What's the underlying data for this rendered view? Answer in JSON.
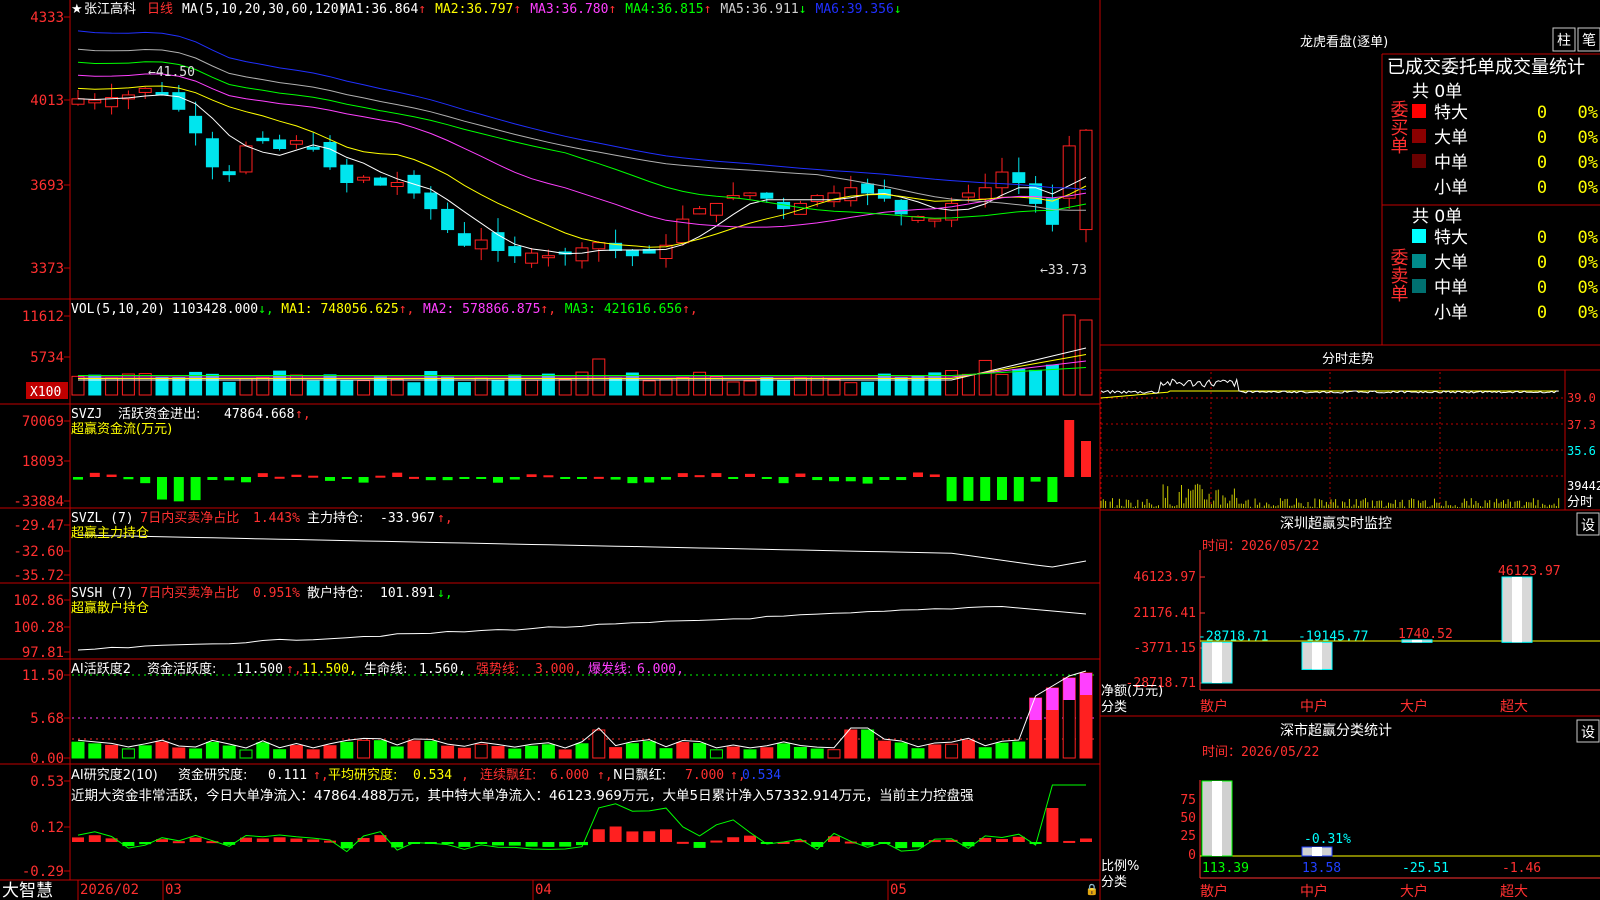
{
  "app": {
    "brand": "大智慧"
  },
  "stock": {
    "star": "★",
    "name": "张江高科",
    "period": "日线"
  },
  "colors": {
    "bg": "#000000",
    "grid": "#c00000",
    "up": "#ff2020",
    "down": "#00e5ee",
    "ma1": "#ffffff",
    "ma2": "#ffff00",
    "ma3": "#ff40ff",
    "ma4": "#00ff00",
    "ma5": "#b0b0b0",
    "ma6": "#2030ff"
  },
  "main": {
    "ma_params": "MA(5,10,20,30,60,120)",
    "ma_values": [
      {
        "label": "MA1:",
        "value": "36.864",
        "arrow": "↑",
        "color": "#ffffff"
      },
      {
        "label": "MA2:",
        "value": "36.797",
        "arrow": "↑",
        "color": "#ffff00"
      },
      {
        "label": "MA3:",
        "value": "36.780",
        "arrow": "↑",
        "color": "#ff40ff"
      },
      {
        "label": "MA4:",
        "value": "36.815",
        "arrow": "↑",
        "color": "#00ff00"
      },
      {
        "label": "MA5:",
        "value": "36.911",
        "arrow": "↓",
        "color": "#d0d0d0"
      },
      {
        "label": "MA6:",
        "value": "39.356",
        "arrow": "↓",
        "color": "#2030ff"
      }
    ],
    "yticks": [
      "4333",
      "4013",
      "3693",
      "3373"
    ],
    "high_label": "41.50",
    "low_label": "33.73"
  },
  "vol": {
    "title": "VOL(5,10,20)",
    "values": [
      {
        "label": "",
        "value": "1103428.000",
        "arrow": "↓",
        "color": "#ffffff"
      },
      {
        "label": "MA1:",
        "value": "748056.625",
        "arrow": "↑",
        "color": "#ffff00"
      },
      {
        "label": "MA2:",
        "value": "578866.875",
        "arrow": "↑",
        "color": "#ff40ff"
      },
      {
        "label": "MA3:",
        "value": "421616.656",
        "arrow": "↑",
        "color": "#00ff00"
      }
    ],
    "yticks": [
      "11612",
      "5734"
    ],
    "unit": "X100"
  },
  "svzj": {
    "title": "SVZJ",
    "label1": "活跃资金进出:",
    "value1": "47864.668",
    "arrow1": "↑,",
    "subtitle": "超赢资金流(万元)",
    "yticks": [
      "70069",
      "18093",
      "-33884"
    ]
  },
  "svzl": {
    "title": "SVZL (7)",
    "label1": "7日内买卖净占比",
    "value1": "1.443%",
    "label2": "主力持仓:",
    "value2": "-33.967",
    "arrow2": "↑,",
    "subtitle": "超赢主力持仓",
    "yticks": [
      "-29.47",
      "-32.60",
      "-35.72"
    ]
  },
  "svsh": {
    "title": "SVSH (7)",
    "label1": "7日内买卖净占比",
    "value1": "0.951%",
    "label2": "散户持仓:",
    "value2": "101.891",
    "arrow2": "↓,",
    "subtitle": "超赢散户持仓",
    "yticks": [
      "102.86",
      "100.28",
      "97.81"
    ]
  },
  "ai1": {
    "title": "AI活跃度2",
    "label1": "资金活跃度:",
    "value1": "11.500",
    "value1b": "11.500,",
    "label2": "生命线:",
    "value2": "1.560,",
    "label3": "强势线:",
    "value3": "3.000,",
    "label4": "爆发线:",
    "value4": "6.000,",
    "yticks": [
      "11.50",
      "5.68",
      "0.00"
    ]
  },
  "ai2": {
    "title": "AI研究度2(10)",
    "label1": "资金研究度:",
    "value1": "0.111",
    "label2": "平均研究度:",
    "value2": "0.534",
    "label3": "连续飘红:",
    "value3": "6.000",
    "label4": "N日飘红:",
    "value4": "7.000",
    "value5": "0.534",
    "note": "近期大资金非常活跃，今日大单净流入：47864.488万元，其中特大单净流入：46123.969万元，大单5日累计净入57332.914万元，当前主力控盘强",
    "yticks": [
      "0.53",
      "0.12",
      "-0.29"
    ]
  },
  "xaxis": {
    "labels": [
      "2026/02",
      "03",
      "04",
      "05"
    ]
  },
  "dragon": {
    "title": "龙虎看盘(逐单)",
    "btn_zhu": "柱",
    "btn_bi": "笔",
    "header": "已成交委托单成交量统计",
    "buy_side": "委买单",
    "sell_side": "委卖单",
    "buy_total": "共 0单",
    "sell_total": "共 0单",
    "buy_rows": [
      {
        "name": "特大",
        "count": "0",
        "pct": "0%",
        "color": "#ff0000"
      },
      {
        "name": "大单",
        "count": "0",
        "pct": "0%",
        "color": "#8b0000"
      },
      {
        "name": "中单",
        "count": "0",
        "pct": "0%",
        "color": "#6a0000"
      },
      {
        "name": "小单",
        "count": "0",
        "pct": "0%",
        "color": ""
      }
    ],
    "sell_rows": [
      {
        "name": "特大",
        "count": "0",
        "pct": "0%",
        "color": "#00ffff"
      },
      {
        "name": "大单",
        "count": "0",
        "pct": "0%",
        "color": "#008b8b"
      },
      {
        "name": "中单",
        "count": "0",
        "pct": "0%",
        "color": "#007070"
      },
      {
        "name": "小单",
        "count": "0",
        "pct": "0%",
        "color": ""
      }
    ]
  },
  "intraday": {
    "title": "分时走势",
    "yticks": [
      "39.0",
      "37.3",
      "35.6",
      "39442"
    ],
    "bottom_label": "分时"
  },
  "monitor": {
    "title": "深圳超赢实时监控",
    "setting": "设",
    "time_label": "时间：",
    "time": "2026/05/22",
    "yticks": [
      "46123.97",
      "21176.41",
      "-3771.15",
      "-28718.71"
    ],
    "ylabel1": "净额(万元)",
    "ylabel2": "分类",
    "bars": [
      {
        "category": "散户",
        "value": "-28718.71"
      },
      {
        "category": "中户",
        "value": "-19145.77"
      },
      {
        "category": "大户",
        "value": "1740.52"
      },
      {
        "category": "超大",
        "value": "46123.97"
      }
    ]
  },
  "classify": {
    "title": "深市超赢分类统计",
    "setting": "设",
    "time_label": "时间：",
    "time": "2026/05/22",
    "yticks": [
      "75",
      "50",
      "25",
      "0"
    ],
    "ylabel1": "比例%",
    "ylabel2": "分类",
    "bars": [
      {
        "category": "散户",
        "value": "113.39"
      },
      {
        "category": "中户",
        "value": "13.58"
      },
      {
        "category": "大户",
        "value": "-25.51"
      },
      {
        "category": "超大",
        "value": "-1.46"
      }
    ],
    "mid_label": "-0.31%"
  }
}
